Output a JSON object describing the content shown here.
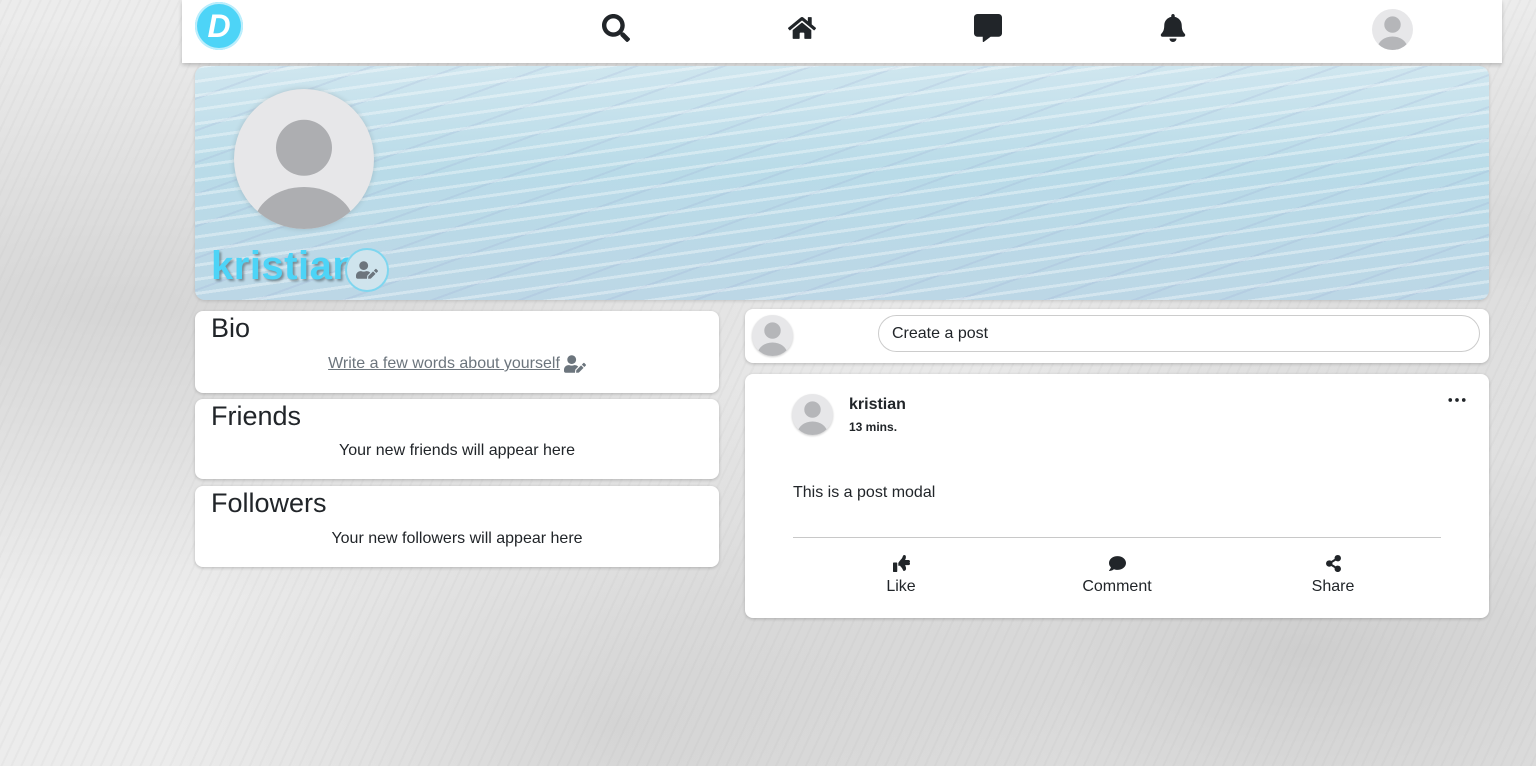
{
  "nav": {
    "logo_letter": "D",
    "icons": [
      "search-icon",
      "home-icon",
      "message-icon",
      "bell-icon"
    ]
  },
  "profile": {
    "name": "kristian"
  },
  "bio": {
    "title": "Bio",
    "placeholder_link": "Write a few words about yourself"
  },
  "friends": {
    "title": "Friends",
    "empty_text": "Your new friends will appear here"
  },
  "followers": {
    "title": "Followers",
    "empty_text": "Your new followers will appear here"
  },
  "create_post": {
    "placeholder": "Create a post"
  },
  "post": {
    "author": "kristian",
    "time": "13 mins.",
    "body": "This is a post modal",
    "actions": {
      "like": "Like",
      "comment": "Comment",
      "share": "Share"
    }
  },
  "colors": {
    "accent": "#4dd4f7",
    "text": "#212529",
    "muted": "#6c757d"
  }
}
